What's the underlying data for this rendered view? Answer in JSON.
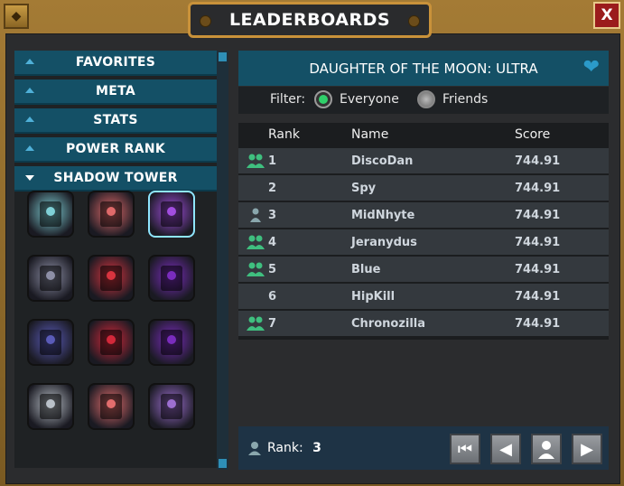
{
  "window": {
    "title": "LEADERBOARDS",
    "close_label": "X"
  },
  "sidebar": {
    "categories": [
      {
        "label": "FAVORITES",
        "expanded": false
      },
      {
        "label": "META",
        "expanded": false
      },
      {
        "label": "STATS",
        "expanded": false
      },
      {
        "label": "POWER RANK",
        "expanded": false
      },
      {
        "label": "SHADOW TOWER",
        "expanded": true
      }
    ],
    "tiles": [
      {
        "icon": "shadow-tower-boss-teal",
        "color": "#7fd0d6"
      },
      {
        "icon": "shadow-tower-boss-red",
        "color": "#e06a6a"
      },
      {
        "icon": "shadow-tower-boss-purple",
        "color": "#a24ee0",
        "selected": true
      },
      {
        "icon": "shadow-beast-grey",
        "color": "#8d8fa6"
      },
      {
        "icon": "shadow-beast-red",
        "color": "#d8343f"
      },
      {
        "icon": "shadow-beast-purple",
        "color": "#7a2cbd"
      },
      {
        "icon": "shadow-mech-blue",
        "color": "#5a5bb8"
      },
      {
        "icon": "shadow-mech-red",
        "color": "#d3283a"
      },
      {
        "icon": "shadow-mech-purple",
        "color": "#7a2cbd"
      },
      {
        "icon": "shadow-knight-white",
        "color": "#b9c0c8"
      },
      {
        "icon": "shadow-knight-red",
        "color": "#e26d6d"
      },
      {
        "icon": "shadow-knight-purple",
        "color": "#9d6fd1"
      }
    ]
  },
  "board": {
    "title": "DAUGHTER OF THE MOON: ULTRA",
    "favorite_icon": "heart-icon",
    "filter_label": "Filter:",
    "filter_options": [
      "Everyone",
      "Friends"
    ],
    "filter_selected": "Everyone",
    "columns": [
      "Rank",
      "Name",
      "Score"
    ],
    "rows": [
      {
        "rank": "1",
        "name": "DiscoDan",
        "score": "744.91",
        "icon": "friends"
      },
      {
        "rank": "2",
        "name": "Spy",
        "score": "744.91",
        "icon": ""
      },
      {
        "rank": "3",
        "name": "MidNhyte",
        "score": "744.91",
        "icon": "self"
      },
      {
        "rank": "4",
        "name": "Jeranydus",
        "score": "744.91",
        "icon": "friends"
      },
      {
        "rank": "5",
        "name": "Blue",
        "score": "744.91",
        "icon": "friends"
      },
      {
        "rank": "6",
        "name": "HipKill",
        "score": "744.91",
        "icon": ""
      },
      {
        "rank": "7",
        "name": "Chronozilla",
        "score": "744.91",
        "icon": "friends"
      }
    ]
  },
  "footer": {
    "rank_label": "Rank:",
    "rank_value": "3"
  },
  "colors": {
    "accent": "#145066",
    "friend_icon": "#3fbf7f",
    "self_icon": "#8aa7ad"
  }
}
